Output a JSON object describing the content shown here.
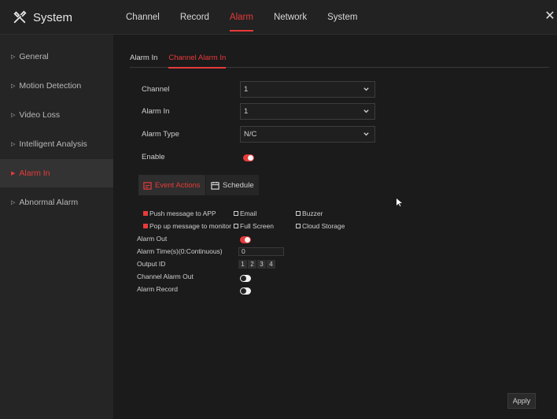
{
  "app": {
    "title": "System",
    "icon": "tools-icon"
  },
  "main_tabs": [
    "Channel",
    "Record",
    "Alarm",
    "Network",
    "System"
  ],
  "active_main_tab": "Alarm",
  "sidebar": {
    "items": [
      {
        "label": "General"
      },
      {
        "label": "Motion Detection"
      },
      {
        "label": "Video Loss"
      },
      {
        "label": "Intelligent Analysis"
      },
      {
        "label": "Alarm In"
      },
      {
        "label": "Abnormal Alarm"
      }
    ],
    "active": "Alarm In"
  },
  "sub_tabs": [
    "Alarm In",
    "Channel Alarm In"
  ],
  "active_sub_tab": "Channel Alarm In",
  "form": {
    "channel_label": "Channel",
    "channel_value": "1",
    "alarm_in_label": "Alarm In",
    "alarm_in_value": "1",
    "alarm_type_label": "Alarm Type",
    "alarm_type_value": "N/C",
    "enable_label": "Enable",
    "enable_on": true
  },
  "action_tabs": {
    "event_actions": "Event Actions",
    "schedule": "Schedule"
  },
  "event_actions": {
    "push_app": {
      "label": "Push message to APP",
      "checked": true
    },
    "email": {
      "label": "Email",
      "checked": false
    },
    "buzzer": {
      "label": "Buzzer",
      "checked": false
    },
    "popup_monitor": {
      "label": "Pop up message to monitor",
      "checked": true
    },
    "full_screen": {
      "label": "Full Screen",
      "checked": false
    },
    "cloud_storage": {
      "label": "Cloud Storage",
      "checked": false
    },
    "alarm_out_label": "Alarm Out",
    "alarm_out_on": true,
    "alarm_time_label": "Alarm Time(s)(0:Continuous)",
    "alarm_time_value": "0",
    "output_id_label": "Output ID",
    "output_ids": [
      "1",
      "2",
      "3",
      "4"
    ],
    "channel_alarm_out_label": "Channel Alarm Out",
    "channel_alarm_out_on": false,
    "alarm_record_label": "Alarm Record",
    "alarm_record_on": false
  },
  "apply_label": "Apply",
  "colors": {
    "accent": "#e83a3a",
    "background": "#1b1b1b",
    "sidebar": "#252525"
  }
}
